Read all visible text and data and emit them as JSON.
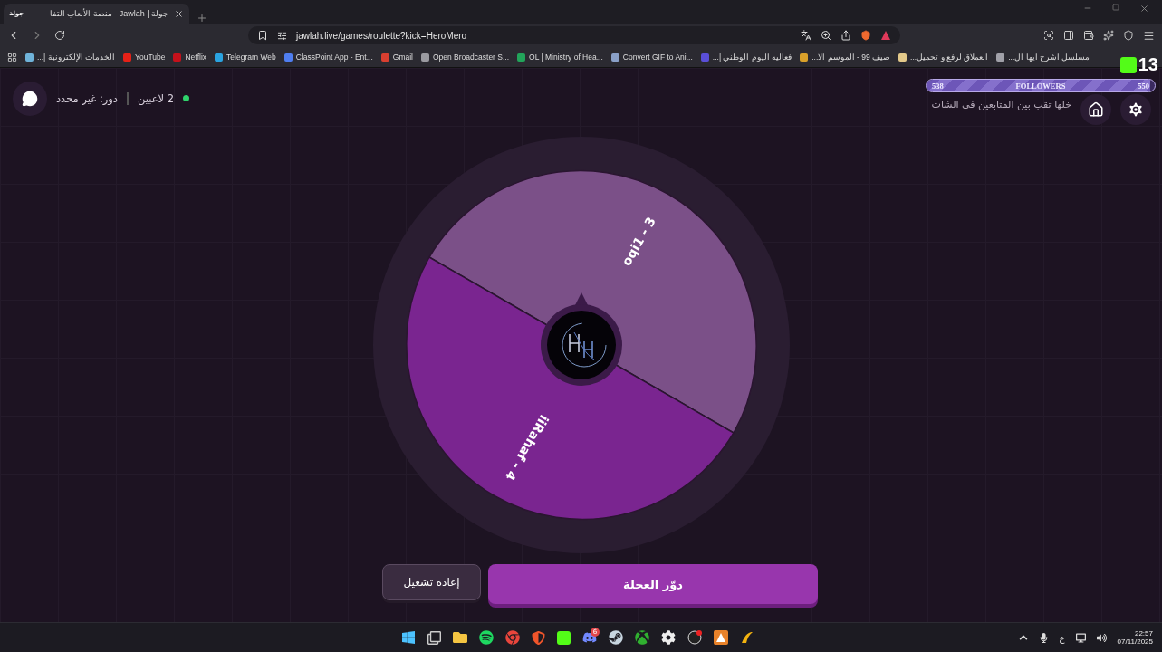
{
  "browser": {
    "tab": {
      "favicon": "جولة",
      "title": "جولة | Jawlah - منصة الألعاب التفا"
    },
    "url": "jawlah.live/games/roulette?kick=HeroMero",
    "bookmarks": [
      {
        "label": "مسلسل اشرح ايها ال...",
        "color": "#a0a0a8"
      },
      {
        "label": "العملاق لرفع و تحميل...",
        "color": "#e3c98a"
      },
      {
        "label": "صيف 99 - الموسم الا...",
        "color": "#d9a02a"
      },
      {
        "label": "فعاليه اليوم الوطني |...",
        "color": "#5a4fd8"
      },
      {
        "label": "Convert GIF to Ani...",
        "color": "#8aa0c8"
      },
      {
        "label": "OL | Ministry of Hea...",
        "color": "#22a45a"
      },
      {
        "label": "Open Broadcaster S...",
        "color": "#9a9aa0"
      },
      {
        "label": "Gmail",
        "color": "#d93f30"
      },
      {
        "label": "ClassPoint App - Ent...",
        "color": "#4f7ef0"
      },
      {
        "label": "Telegram Web",
        "color": "#2aa3e0"
      },
      {
        "label": "Netflix",
        "color": "#c4111b"
      },
      {
        "label": "YouTube",
        "color": "#e62117"
      },
      {
        "label": "الخدمات الإلكترونية |...",
        "color": "#6fb3d9"
      }
    ]
  },
  "overlay": {
    "kick_count": "13",
    "followers": {
      "start": "538",
      "label": "FOLLOWERS",
      "goal": "550",
      "level": 0.98
    }
  },
  "header": {
    "players": "2 لاعبين",
    "online": true,
    "turn": "دور: غير محدد",
    "subtitle": "خلها تقب بين المتابعين في الشات"
  },
  "wheel": {
    "segments": [
      {
        "label": "oqi1 - 3",
        "color": "#7b5088"
      },
      {
        "label": "iiRahaf - 4",
        "color": "#7a2590"
      }
    ]
  },
  "buttons": [
    {
      "label": "دوّر العجلة",
      "kind": "primary"
    },
    {
      "label": "إعادة تشغيل",
      "kind": "secondary"
    }
  ],
  "taskbar": {
    "discord_badge": "6",
    "language": "ع",
    "time": "22:57",
    "date": "07/11/2025"
  }
}
